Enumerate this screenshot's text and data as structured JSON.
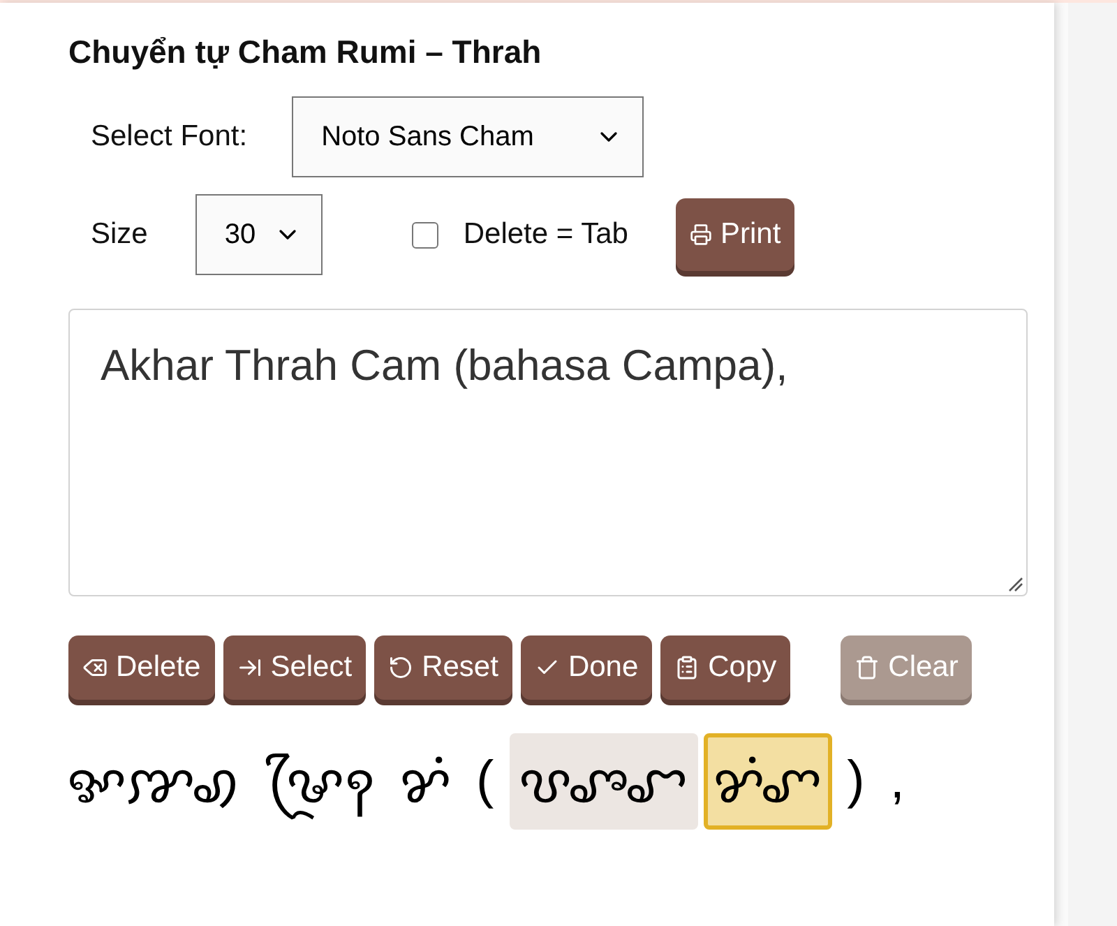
{
  "title": "Chuyển tự Cham Rumi – Thrah",
  "font": {
    "label": "Select Font:",
    "value": "Noto Sans Cham"
  },
  "size": {
    "label": "Size",
    "value": "30"
  },
  "delete_tab": {
    "label": "Delete = Tab",
    "checked": false
  },
  "print_button": {
    "label": "Print",
    "kind": "print"
  },
  "input": {
    "value": "Akhar Thrah Cam (bahasa Campa),"
  },
  "buttons": [
    {
      "label": "Delete",
      "kind": "delete",
      "disabled": false
    },
    {
      "label": "Select",
      "kind": "select",
      "disabled": false
    },
    {
      "label": "Reset",
      "kind": "reset",
      "disabled": false
    },
    {
      "label": "Done",
      "kind": "done",
      "disabled": false
    },
    {
      "label": "Copy",
      "kind": "copy",
      "disabled": false
    },
    {
      "label": "Clear",
      "kind": "clear",
      "disabled": true
    }
  ],
  "output": [
    {
      "text": "ꨀꨇꩉ",
      "matched": false,
      "current": false
    },
    {
      "text": "ꨔꨴꩍ",
      "matched": false,
      "current": false
    },
    {
      "text": "ꨌꩌ",
      "matched": false,
      "current": false
    },
    {
      "text": "(",
      "matched": false,
      "current": false
    },
    {
      "text": "ꨝꨨꨧ",
      "matched": true,
      "current": false
    },
    {
      "text": "ꨌꩌꨚ",
      "matched": false,
      "current": true
    },
    {
      "text": ")",
      "matched": false,
      "current": false
    },
    {
      "text": ",",
      "matched": false,
      "current": false
    }
  ]
}
